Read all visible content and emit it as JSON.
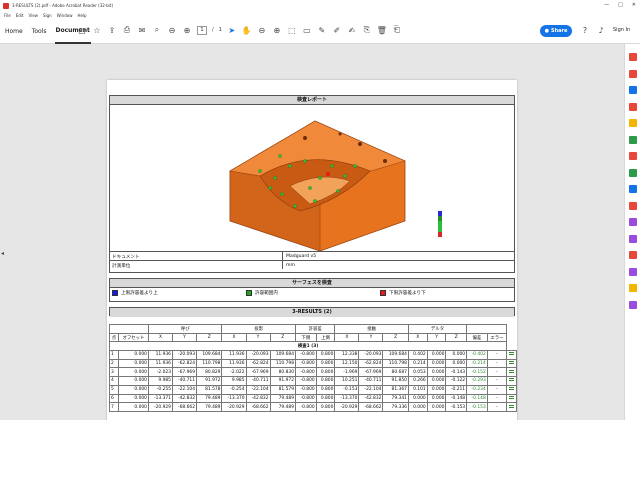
{
  "window": {
    "title": "3-RESULTS (2).pdf - Adobe Acrobat Reader (32-bit)",
    "minimize": "—",
    "maximize": "□",
    "close": "✕"
  },
  "menu": [
    "File",
    "Edit",
    "View",
    "Sign",
    "Window",
    "Help"
  ],
  "tabs": [
    {
      "label": "Home"
    },
    {
      "label": "Tools"
    },
    {
      "label": "Document"
    }
  ],
  "toolbar": {
    "page_current": "1",
    "page_sep": "/",
    "page_total": "1",
    "share_label": "Share",
    "signin_label": "Sign In",
    "icons": [
      "new-file-icon",
      "save-icon",
      "print-icon",
      "upload-icon",
      "print-icon",
      "email-icon",
      "search-icon",
      "zoom-out-icon",
      "zoom-in-icon",
      "page-up-icon",
      "page-down-icon",
      "cursor-icon",
      "hand-icon",
      "zoom-icon",
      "fit-icon",
      "comment-icon",
      "pen-icon",
      "highlight-icon",
      "sign-icon",
      "stamp-icon",
      "delete-icon",
      "save-as-icon"
    ]
  },
  "right_panel_colors": [
    "#e8483b",
    "#e8483b",
    "#1473e6",
    "#e8483b",
    "#f5b400",
    "#2d9c4a",
    "#e8483b",
    "#2d9c4a",
    "#1473e6",
    "#e8483b",
    "#9a4be0",
    "#9a4be0",
    "#e8483b",
    "#9a4be0",
    "#f5b400",
    "#9a4be0"
  ],
  "report": {
    "title": "検査レポート",
    "document_label": "ドキュメント",
    "document_value": "Madguard v5",
    "unit_label": "計測単位",
    "unit_value": "mm",
    "model_color": "#e8731f",
    "scale_colors": [
      "#2a2ad6",
      "#2a8a2a",
      "#2dbf3a",
      "#2dbf3a",
      "#d62a2a"
    ]
  },
  "surface": {
    "title": "サーフェスを検査",
    "legend": [
      {
        "label": "上限許容差より上",
        "color": "#1a1ae6"
      },
      {
        "label": "許容範囲内",
        "color": "#1fa51f"
      },
      {
        "label": "下限許容差より下",
        "color": "#e61a1a"
      }
    ]
  },
  "results": {
    "title": "3-RESULTS (2)",
    "group_headers": [
      "呼び",
      "投影",
      "許容差",
      "接触",
      "デルタ"
    ],
    "col_point": "点",
    "col_offset": "オフセット",
    "col_x": "X",
    "col_y": "Y",
    "col_z": "Z",
    "col_tol_low": "下側",
    "col_tol_high": "上側",
    "col_dev": "偏差",
    "col_err": "エラー",
    "subheader": "検査1 (3)",
    "rows": [
      {
        "n": "1",
        "off": "0.000",
        "nx": "11.936",
        "ny": "-20.093",
        "nz": "109.684",
        "px": "11.936",
        "py": "-20.093",
        "pz": "109.684",
        "tl": "-0.800",
        "th": "0.800",
        "cx": "12.338",
        "cy": "-20.093",
        "cz": "109.684",
        "dx": "0.402",
        "dy": "0.000",
        "dz": "0.000",
        "dev": "-0.402",
        "err": "-"
      },
      {
        "n": "2",
        "off": "0.000",
        "nx": "11.936",
        "ny": "-62.824",
        "nz": "110.798",
        "px": "11.936",
        "py": "-62.824",
        "pz": "110.798",
        "tl": "-0.800",
        "th": "0.800",
        "cx": "12.150",
        "cy": "-62.824",
        "cz": "110.798",
        "dx": "0.214",
        "dy": "0.000",
        "dz": "0.000",
        "dev": "-0.214",
        "err": "-"
      },
      {
        "n": "3",
        "off": "0.000",
        "nx": "-2.023",
        "ny": "-67.969",
        "nz": "80.829",
        "px": "-2.022",
        "py": "-67.969",
        "pz": "80.830",
        "tl": "-0.800",
        "th": "0.800",
        "cx": "-1.969",
        "cy": "-67.969",
        "cz": "80.687",
        "dx": "0.053",
        "dy": "0.000",
        "dz": "-0.143",
        "dev": "-0.152",
        "err": "-"
      },
      {
        "n": "4",
        "off": "0.000",
        "nx": "9.985",
        "ny": "-40.711",
        "nz": "91.972",
        "px": "9.985",
        "py": "-40.711",
        "pz": "91.972",
        "tl": "-0.800",
        "th": "0.800",
        "cx": "10.251",
        "cy": "-40.711",
        "cz": "91.850",
        "dx": "0.266",
        "dy": "0.000",
        "dz": "-0.122",
        "dev": "-0.293",
        "err": "-"
      },
      {
        "n": "5",
        "off": "0.000",
        "nx": "-0.255",
        "ny": "-22.104",
        "nz": "81.578",
        "px": "-0.254",
        "py": "-22.104",
        "pz": "81.579",
        "tl": "-0.800",
        "th": "0.800",
        "cx": "-0.153",
        "cy": "-22.104",
        "cz": "81.367",
        "dx": "0.101",
        "dy": "0.000",
        "dz": "-0.211",
        "dev": "-0.234",
        "err": "-"
      },
      {
        "n": "6",
        "off": "0.000",
        "nx": "-13.371",
        "ny": "-42.832",
        "nz": "79.489",
        "px": "-13.370",
        "py": "-42.832",
        "pz": "79.489",
        "tl": "-0.800",
        "th": "0.800",
        "cx": "-13.370",
        "cy": "-42.832",
        "cz": "79.341",
        "dx": "0.000",
        "dy": "0.000",
        "dz": "-0.148",
        "dev": "-0.148",
        "err": "-"
      },
      {
        "n": "7",
        "off": "0.000",
        "nx": "-20.929",
        "ny": "-68.662",
        "nz": "79.489",
        "px": "-20.929",
        "py": "-68.662",
        "pz": "79.489",
        "tl": "-0.800",
        "th": "0.800",
        "cx": "-20.929",
        "cy": "-68.662",
        "cz": "79.336",
        "dx": "0.000",
        "dy": "0.000",
        "dz": "-0.153",
        "dev": "-0.153",
        "err": "-"
      }
    ]
  }
}
